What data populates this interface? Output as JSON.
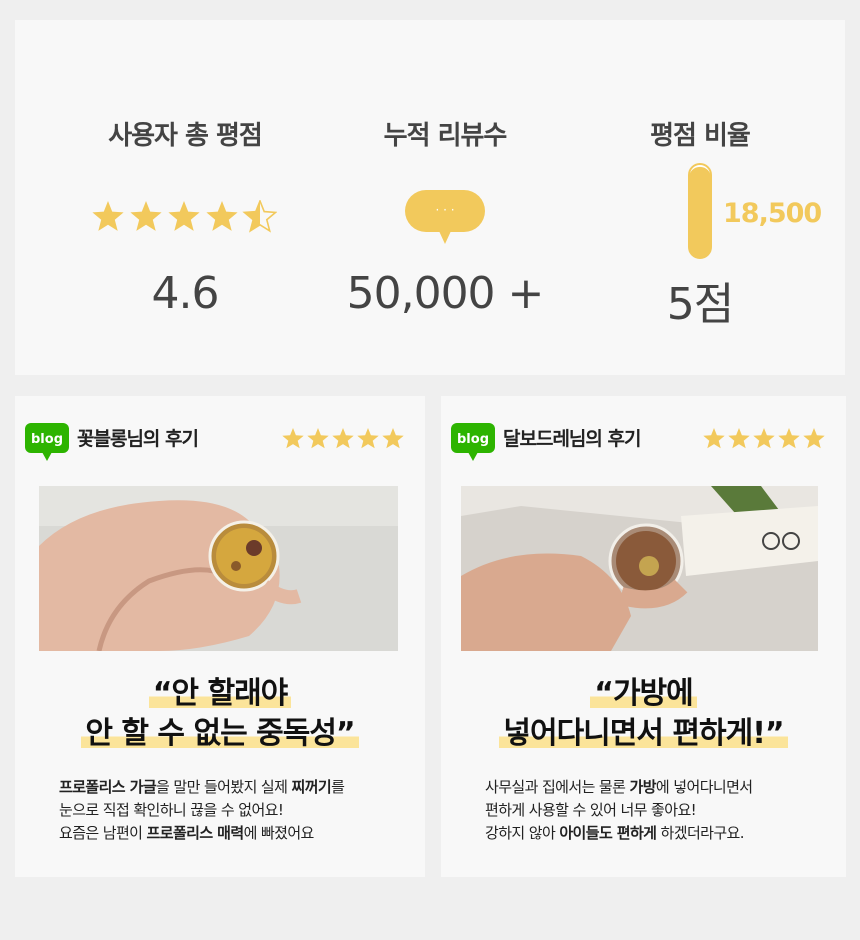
{
  "summary": {
    "rating": {
      "heading": "사용자 총 평점",
      "value": "4.6",
      "stars": 4.6,
      "star_color": "#f2c95c"
    },
    "reviews": {
      "heading": "누적 리뷰수",
      "value": "50,000 +",
      "bubble_text": "· · ·",
      "bubble_color": "#f2c95c"
    },
    "ratio": {
      "heading": "평점 비율",
      "value": "5점",
      "count": "18,500",
      "gauge_color": "#f2c95c",
      "gauge_fill": 0.97
    }
  },
  "reviews": [
    {
      "badge": "blog",
      "author": "꽃블롱님의 후기",
      "stars": 5,
      "photo_icon": "gold-gel-cup-in-hand",
      "quote_line1": "“안 할래야",
      "quote_line2": "안 할 수 없는 중독성”",
      "body_1a": "프로폴리스 가글",
      "body_1b": "을 말만 들어봤지 실제 ",
      "body_1c": "찌꺼기",
      "body_1d": "를",
      "body_2": "눈으로 직접 확인하니 끊을 수 없어요!",
      "body_3a": "요즘은 남편이 ",
      "body_3b": "프로폴리스 매력",
      "body_3c": "에 빠졌어요"
    },
    {
      "badge": "blog",
      "author": "달보드레님의 후기",
      "stars": 5,
      "photo_icon": "gargle-pouch-pour",
      "quote_line1": "“가방에",
      "quote_line2": "넣어다니면서 편하게!”",
      "body_1a": "사무실과 집에서는 물론 ",
      "body_1b": "가방",
      "body_1c": "에 넣어다니면서",
      "body_2": "편하게 사용할 수 있어 너무 좋아요!",
      "body_3a": "강하지 않아 ",
      "body_3b": "아이들도 편하게",
      "body_3c": " 하겠더라구요."
    }
  ],
  "colors": {
    "accent": "#f2c95c",
    "blog_green": "#2db400",
    "highlight": "#fbe49a"
  }
}
